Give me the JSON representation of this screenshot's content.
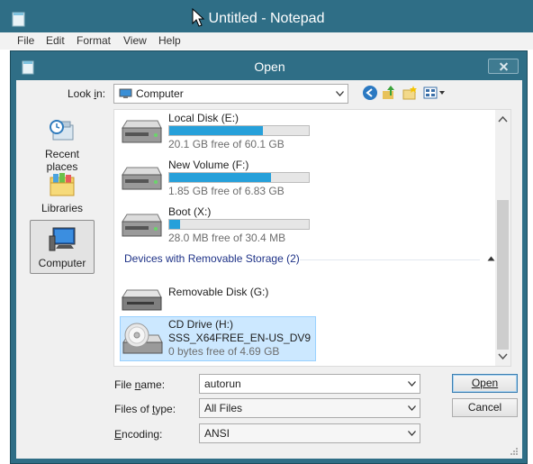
{
  "notepad": {
    "title": "Untitled - Notepad",
    "menu": [
      "File",
      "Edit",
      "Format",
      "View",
      "Help"
    ]
  },
  "dialog": {
    "title": "Open",
    "look_in": {
      "label": "Look in:",
      "value": "Computer"
    },
    "toolbar_icons": [
      "back-icon",
      "up-folder-icon",
      "new-folder-icon",
      "view-menu-icon"
    ],
    "places": [
      {
        "label": "Recent places",
        "icon": "recent-places-icon"
      },
      {
        "label": "Libraries",
        "icon": "libraries-icon"
      },
      {
        "label": "Computer",
        "icon": "computer-icon",
        "selected": true
      }
    ],
    "drives": [
      {
        "name": "Local Disk (E:)",
        "free": "20.1 GB free of 60.1 GB",
        "used_fraction": 0.67
      },
      {
        "name": "New Volume (F:)",
        "free": "1.85 GB free of 6.83 GB",
        "used_fraction": 0.73
      },
      {
        "name": "Boot (X:)",
        "free": "28.0 MB free of 30.4 MB",
        "used_fraction": 0.08
      }
    ],
    "removable_group": "Devices with Removable Storage (2)",
    "removable": [
      {
        "name": "Removable Disk (G:)"
      },
      {
        "name": "CD Drive (H:)",
        "label": "SSS_X64FREE_EN-US_DV9",
        "free": "0 bytes free of 4.69 GB",
        "selected": true
      }
    ],
    "file_name": {
      "label": "File name:",
      "value": "autorun"
    },
    "files_of_type": {
      "label": "Files of type:",
      "value": "All Files"
    },
    "encoding": {
      "label": "Encoding:",
      "value": "ANSI"
    },
    "buttons": {
      "open": "Open",
      "cancel": "Cancel"
    }
  },
  "colors": {
    "titlebar": "#2f6e86",
    "progress": "#26a0da",
    "selection": "#cce8ff"
  }
}
